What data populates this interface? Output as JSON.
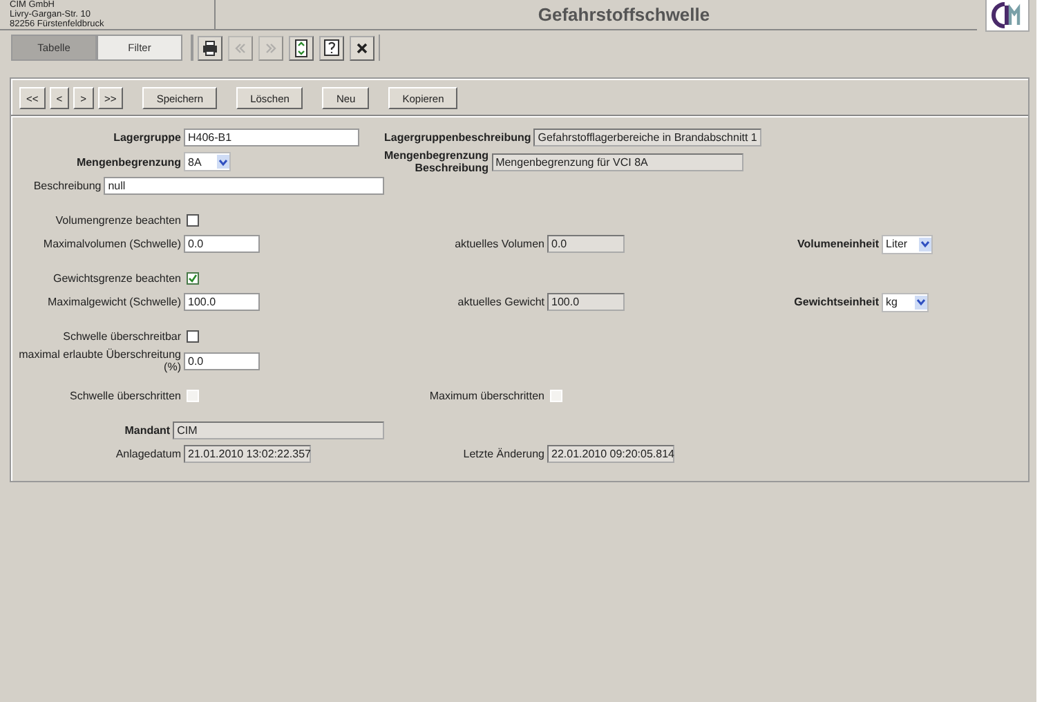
{
  "header": {
    "address_lines": [
      "CIM GmbH",
      "Livry-Gargan-Str. 10",
      "82256 Fürstenfeldbruck"
    ],
    "title": "Gefahrstoffschwelle"
  },
  "tabs": [
    {
      "label": "Tabelle",
      "selected": true
    },
    {
      "label": "Filter",
      "selected": false
    }
  ],
  "toolbar": [
    {
      "kind": "print",
      "disabled": false
    },
    {
      "kind": "back",
      "disabled": true
    },
    {
      "kind": "forward",
      "disabled": true
    },
    {
      "kind": "refresh",
      "disabled": false
    },
    {
      "kind": "help",
      "disabled": false
    },
    {
      "kind": "close",
      "disabled": false
    }
  ],
  "record_nav": [
    "<<",
    "<",
    ">",
    ">>"
  ],
  "actions": [
    "Speichern",
    "Löschen",
    "Neu",
    "Kopieren"
  ],
  "sections": [
    [
      [
        {
          "label": "Lagergruppe",
          "bold": true,
          "kind": "text",
          "value": "H406-B1"
        },
        {
          "label": "Lagergruppenbeschreibung",
          "bold": true,
          "kind": "readonly",
          "value": "Gefahrstofflagerbereiche in Brandabschnitt 1"
        }
      ],
      [
        {
          "label": "Mengenbegrenzung",
          "bold": true,
          "kind": "select",
          "value": "8A"
        },
        {
          "label": "Mengenbegrenzung Beschreibung",
          "bold": true,
          "kind": "readonly",
          "value": "Mengenbegrenzung für VCI 8A"
        }
      ],
      [
        {
          "label": "Beschreibung",
          "bold": false,
          "kind": "text",
          "value": "null"
        }
      ]
    ],
    [
      [
        {
          "label": "Volumengrenze beachten",
          "bold": false,
          "kind": "checkbox",
          "checked": false,
          "disabled": false
        }
      ],
      [
        {
          "label": "Maximalvolumen (Schwelle)",
          "bold": false,
          "kind": "text",
          "value": "0.0"
        },
        {
          "label": "aktuelles Volumen",
          "bold": false,
          "kind": "readonly",
          "value": "0.0"
        },
        {
          "label": "Volumeneinheit",
          "bold": true,
          "kind": "select",
          "value": "Liter"
        }
      ]
    ],
    [
      [
        {
          "label": "Gewichtsgrenze beachten",
          "bold": false,
          "kind": "checkbox",
          "checked": true,
          "disabled": false
        }
      ],
      [
        {
          "label": "Maximalgewicht (Schwelle)",
          "bold": false,
          "kind": "text",
          "value": "100.0"
        },
        {
          "label": "aktuelles Gewicht",
          "bold": false,
          "kind": "readonly",
          "value": "100.0"
        },
        {
          "label": "Gewichtseinheit",
          "bold": true,
          "kind": "select",
          "value": "kg"
        }
      ]
    ],
    [
      [
        {
          "label": "Schwelle überschreitbar",
          "bold": false,
          "kind": "checkbox",
          "checked": false,
          "disabled": false
        }
      ],
      [
        {
          "label": "maximal erlaubte Überschreitung (%)",
          "bold": false,
          "kind": "text",
          "value": "0.0"
        }
      ]
    ],
    [
      [
        {
          "label": "Schwelle überschritten",
          "bold": false,
          "kind": "checkbox",
          "checked": false,
          "disabled": true
        },
        {
          "label": "Maximum überschritten",
          "bold": false,
          "kind": "checkbox",
          "checked": false,
          "disabled": true
        }
      ]
    ],
    [
      [
        {
          "label": "Mandant",
          "bold": true,
          "kind": "readonly",
          "value": "CIM"
        }
      ],
      [
        {
          "label": "Anlagedatum",
          "bold": false,
          "kind": "readonly",
          "value": "21.01.2010 13:02:22.357"
        },
        {
          "label": "Letzte Änderung",
          "bold": false,
          "kind": "readonly",
          "value": "22.01.2010 09:20:05.814"
        }
      ]
    ]
  ]
}
